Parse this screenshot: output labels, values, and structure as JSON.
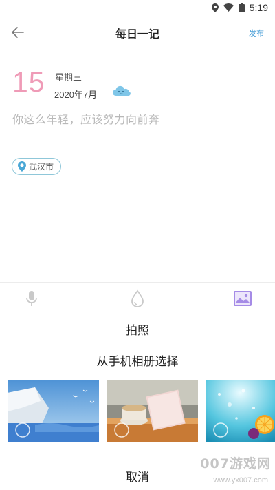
{
  "status_bar": {
    "time": "5:19",
    "icons": [
      "location-icon",
      "wifi-icon",
      "battery-icon"
    ]
  },
  "header": {
    "title": "每日一记",
    "publish_label": "发布",
    "back_icon": "arrow-left-icon"
  },
  "entry": {
    "day": "15",
    "weekday": "星期三",
    "year_month": "2020年7月",
    "weather_icon": "cloud-icon",
    "text": "你这么年轻，应该努力向前奔",
    "location": "武汉市"
  },
  "toolbar": {
    "tools": [
      "microphone-icon",
      "water-drop-icon",
      "image-icon"
    ],
    "active": "image-icon",
    "active_color": "#a58be6"
  },
  "sheet": {
    "take_photo": "拍照",
    "choose_album": "从手机相册选择",
    "cancel": "取消"
  },
  "photos": [
    "anime-sky-sea-photo",
    "cafe-notebook-photo",
    "underwater-fruit-photo"
  ],
  "watermark": {
    "logo": "007游戏网",
    "url": "www.yx007.com"
  },
  "colors": {
    "accent": "#4a9fd8",
    "day": "#ef9bb7",
    "location_border": "#8fc7d9"
  }
}
